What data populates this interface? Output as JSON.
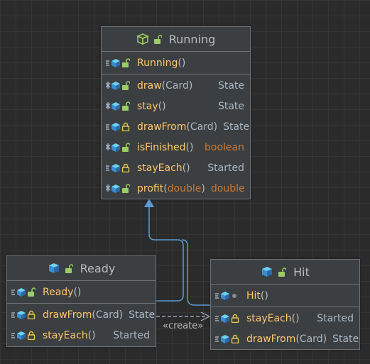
{
  "classes": {
    "running": {
      "name": "Running",
      "constructor": {
        "name": "Running",
        "params": ""
      },
      "methods": [
        {
          "name": "draw",
          "params": "Card",
          "params_primitive": false,
          "returns": "State",
          "returns_primitive": false,
          "kind": "abstract",
          "access": "public"
        },
        {
          "name": "stay",
          "params": "",
          "params_primitive": false,
          "returns": "State",
          "returns_primitive": false,
          "kind": "abstract",
          "access": "public"
        },
        {
          "name": "drawFrom",
          "params": "Card",
          "params_primitive": false,
          "returns": "State",
          "returns_primitive": false,
          "kind": "method",
          "access": "protected"
        },
        {
          "name": "isFinished",
          "params": "",
          "params_primitive": false,
          "returns": "boolean",
          "returns_primitive": true,
          "kind": "abstract",
          "access": "public"
        },
        {
          "name": "stayEach",
          "params": "",
          "params_primitive": false,
          "returns": "Started",
          "returns_primitive": false,
          "kind": "method",
          "access": "protected"
        },
        {
          "name": "profit",
          "params": "double",
          "params_primitive": true,
          "returns": "double",
          "returns_primitive": true,
          "kind": "abstract",
          "access": "public"
        }
      ]
    },
    "ready": {
      "name": "Ready",
      "constructor": {
        "name": "Ready",
        "params": ""
      },
      "methods": [
        {
          "name": "drawFrom",
          "params": "Card",
          "params_primitive": false,
          "returns": "State",
          "returns_primitive": false,
          "kind": "method",
          "access": "protected"
        },
        {
          "name": "stayEach",
          "params": "",
          "params_primitive": false,
          "returns": "Started",
          "returns_primitive": false,
          "kind": "method",
          "access": "protected"
        }
      ]
    },
    "hit": {
      "name": "Hit",
      "constructor": {
        "name": "Hit",
        "params": ""
      },
      "methods": [
        {
          "name": "stayEach",
          "params": "",
          "params_primitive": false,
          "returns": "Started",
          "returns_primitive": false,
          "kind": "method",
          "access": "protected"
        },
        {
          "name": "drawFrom",
          "params": "Card",
          "params_primitive": false,
          "returns": "State",
          "returns_primitive": false,
          "kind": "method",
          "access": "protected"
        }
      ]
    }
  },
  "edges": {
    "create_label": "«create»"
  },
  "colors": {
    "inheritance": "#5b9bd5",
    "dependency": "#a9b7c6",
    "method_name": "#ffc66d",
    "primitive_type": "#cc7832",
    "type": "#a9b7c6"
  }
}
